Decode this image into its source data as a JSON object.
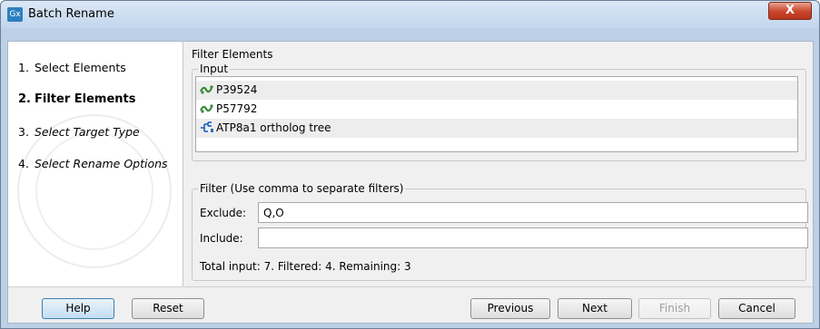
{
  "window": {
    "icon_text": "Gx",
    "title": "Batch Rename",
    "close_label": "X"
  },
  "steps": [
    {
      "num": "1.",
      "label": "Select Elements",
      "state": "done"
    },
    {
      "num": "2.",
      "label": "Filter Elements",
      "state": "active"
    },
    {
      "num": "3.",
      "label": "Select Target Type",
      "state": "future"
    },
    {
      "num": "4.",
      "label": "Select Rename Options",
      "state": "future"
    }
  ],
  "panel": {
    "title": "Filter Elements",
    "input_legend": "Input",
    "input_items": [
      {
        "label": "P39524",
        "icon": "sequence-icon"
      },
      {
        "label": "P57792",
        "icon": "sequence-icon"
      },
      {
        "label": "ATP8a1 ortholog tree",
        "icon": "tree-icon"
      }
    ],
    "filter_legend": "Filter (Use comma to separate filters)",
    "exclude_label": "Exclude:",
    "exclude_value": "Q,O",
    "include_label": "Include:",
    "include_value": "",
    "summary": "Total input: 7. Filtered: 4. Remaining: 3"
  },
  "footer": {
    "help": "Help",
    "reset": "Reset",
    "previous": "Previous",
    "next": "Next",
    "finish": "Finish",
    "cancel": "Cancel"
  },
  "colors": {
    "title_bar": "#c2d6ec",
    "close_button": "#c9452a",
    "primary_button": "#3c7fb1",
    "sequence_icon": "#3a8a3a",
    "tree_icon": "#2d6fc0"
  }
}
